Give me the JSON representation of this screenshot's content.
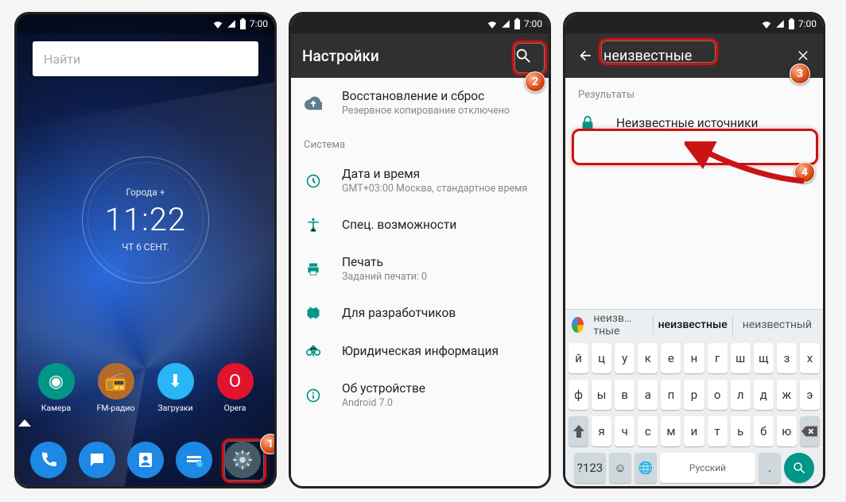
{
  "status": {
    "time": "7:00"
  },
  "screen1": {
    "search_placeholder": "Найти",
    "clock_city": "Города +",
    "clock_time": "11:22",
    "clock_date": "чт 6 сент.",
    "apps": [
      {
        "label": "Камера",
        "color": "#009688",
        "glyph": "◉"
      },
      {
        "label": "FM-радио",
        "color": "#b36b2a",
        "glyph": "📻"
      },
      {
        "label": "Загрузки",
        "color": "#29b6f6",
        "glyph": "⬇"
      },
      {
        "label": "Opera",
        "color": "#e2142d",
        "glyph": "O"
      }
    ],
    "dock": [
      {
        "name": "phone",
        "color": "#1e88e5",
        "glyph": "phone"
      },
      {
        "name": "messages",
        "color": "#1e88e5",
        "glyph": "msg"
      },
      {
        "name": "contacts",
        "color": "#1e88e5",
        "glyph": "ppl"
      },
      {
        "name": "files",
        "color": "#1e88e5",
        "glyph": "es"
      },
      {
        "name": "settings",
        "color": "#607d8b",
        "glyph": "gear"
      }
    ]
  },
  "screen2": {
    "title": "Настройки",
    "backup": {
      "title": "Восстановление и сброс",
      "sub": "Резервное копирование отключено"
    },
    "section_system": "Система",
    "items": [
      {
        "title": "Дата и время",
        "sub": "GMT+03:00 Москва, стандартное время",
        "icon": "clock"
      },
      {
        "title": "Спец. возможности",
        "sub": "",
        "icon": "access"
      },
      {
        "title": "Печать",
        "sub": "Заданий печати: 0",
        "icon": "print"
      },
      {
        "title": "Для разработчиков",
        "sub": "",
        "icon": "dev"
      },
      {
        "title": "Юридическая информация",
        "sub": "",
        "icon": "legal"
      },
      {
        "title": "Об устройстве",
        "sub": "Android 7.0",
        "icon": "info"
      }
    ]
  },
  "screen3": {
    "query": "неизвестные",
    "results_label": "Результаты",
    "result": "Неизвестные источники",
    "suggestions": [
      "неизв…тные",
      "неизвестные",
      "неизвестный"
    ],
    "keys_r1": [
      "й",
      "ц",
      "у",
      "к",
      "е",
      "н",
      "г",
      "ш",
      "щ",
      "з",
      "х"
    ],
    "keys_r2": [
      "ф",
      "ы",
      "в",
      "а",
      "п",
      "р",
      "о",
      "л",
      "д",
      "ж",
      "э"
    ],
    "keys_r3": [
      "я",
      "ч",
      "с",
      "м",
      "и",
      "т",
      "ь",
      "б",
      "ю"
    ],
    "numkey": "?123",
    "space_label": "Русский"
  },
  "steps": [
    "1",
    "2",
    "3",
    "4"
  ]
}
